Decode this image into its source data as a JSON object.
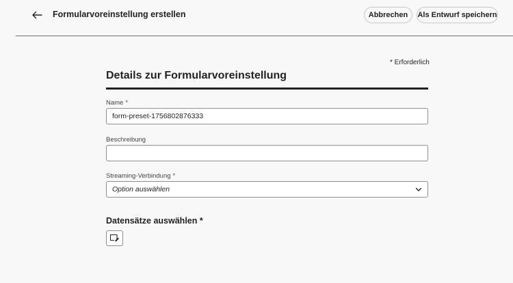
{
  "header": {
    "title": "Formularvoreinstellung erstellen",
    "cancel_label": "Abbrechen",
    "draft_label": "Als Entwurf speichern"
  },
  "form": {
    "required_note": "* Erforderlich",
    "section_title": "Details zur Formularvoreinstellung",
    "required_marker": "*",
    "name": {
      "label": "Name",
      "value": "form-preset-1756802876333"
    },
    "description": {
      "label": "Beschreibung",
      "value": ""
    },
    "streaming": {
      "label": "Streaming-Verbindung",
      "placeholder": "Option auswählen"
    },
    "datasets": {
      "title": "Datensätze auswählen *"
    }
  },
  "icons": {
    "back": "arrow-left-icon",
    "chevron": "chevron-down-icon",
    "dataset": "edit-dataset-icon"
  }
}
